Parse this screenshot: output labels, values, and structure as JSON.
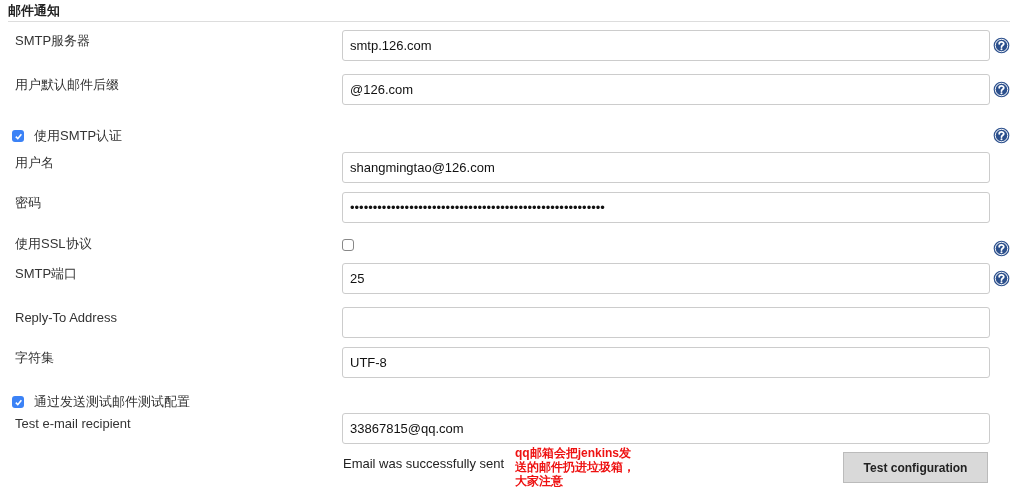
{
  "section_title": "邮件通知",
  "rows": [
    {
      "kind": "text",
      "label": "SMTP服务器",
      "value": "smtp.126.com",
      "help": true
    },
    {
      "kind": "text",
      "label": "用户默认邮件后缀",
      "value": "@126.com",
      "help": true
    },
    {
      "kind": "check",
      "label": "使用SMTP认证",
      "checked": true,
      "help": true
    },
    {
      "kind": "text",
      "label": "用户名",
      "value": "shangmingtao@126.com",
      "help": false
    },
    {
      "kind": "text",
      "label": "密码",
      "value": "••••••••••••••••••••••••••••••••••••••••••••••••••••••••",
      "help": false
    },
    {
      "kind": "inline-check",
      "label": "使用SSL协议",
      "checked": false,
      "help": true
    },
    {
      "kind": "text",
      "label": "SMTP端口",
      "value": "25",
      "help": true
    },
    {
      "kind": "text",
      "label": "Reply-To Address",
      "value": "",
      "help": false
    },
    {
      "kind": "text",
      "label": "字符集",
      "value": "UTF-8",
      "help": false
    },
    {
      "kind": "check",
      "label": "通过发送测试邮件测试配置",
      "checked": true,
      "help": false
    },
    {
      "kind": "text",
      "label": "Test e-mail recipient",
      "value": "33867815@qq.com",
      "help": false
    }
  ],
  "result_message": "Email was successfully sent",
  "test_button": "Test configuration",
  "annotation": "qq邮箱会把jenkins发送的邮件扔进垃圾箱，大家注意"
}
